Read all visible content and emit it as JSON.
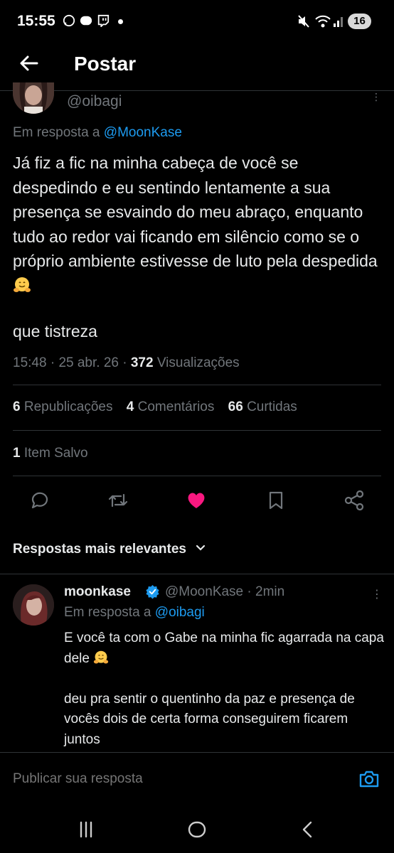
{
  "status_bar": {
    "time": "15:55",
    "battery": "16",
    "left_icons": [
      "whatsapp-icon",
      "weibo-icon",
      "twitch-icon"
    ],
    "right_icons": [
      "mute-icon",
      "wifi-icon",
      "signal-icon"
    ]
  },
  "header": {
    "title": "Postar"
  },
  "post": {
    "handle": "@oibagi",
    "reply_prefix": "Em resposta a",
    "reply_to": "@MoonKase",
    "text": "Já fiz a fic na minha cabeça de você se despedindo e eu sentindo lentamente a sua presença se esvaindo do meu abraço, enquanto tudo ao redor vai ficando em silêncio como se o próprio ambiente estivesse de luto pela despedida",
    "text_extra": "que tistreza",
    "time": "15:48",
    "date": "25 abr. 26",
    "views_count": "372",
    "views_label": "Visualizações"
  },
  "stats": {
    "reposts_count": "6",
    "reposts_label": "Republicações",
    "comments_count": "4",
    "comments_label": "Comentários",
    "likes_count": "66",
    "likes_label": "Curtidas",
    "saved_count": "1",
    "saved_label": "Item Salvo"
  },
  "actions": [
    "reply-icon",
    "retweet-icon",
    "heart-icon",
    "bookmark-icon",
    "share-icon"
  ],
  "colors": {
    "accent": "#1d9bf0",
    "like": "#f91880",
    "muted": "#71767b",
    "text": "#e7e9ea",
    "background": "#000000"
  },
  "sort_label": "Respostas mais relevantes",
  "reply": {
    "name": "moonkase",
    "handle": "@MoonKase",
    "time": "· 2min",
    "reply_prefix": "Em resposta a",
    "reply_to": "@oibagi",
    "text1": "E você ta com o Gabe na minha fic agarrada na capa dele",
    "text2": " deu pra sentir o quentinho da paz e presença de vocês dois de certa forma conseguirem ficarem juntos"
  },
  "compose": {
    "placeholder": "Publicar sua resposta"
  }
}
